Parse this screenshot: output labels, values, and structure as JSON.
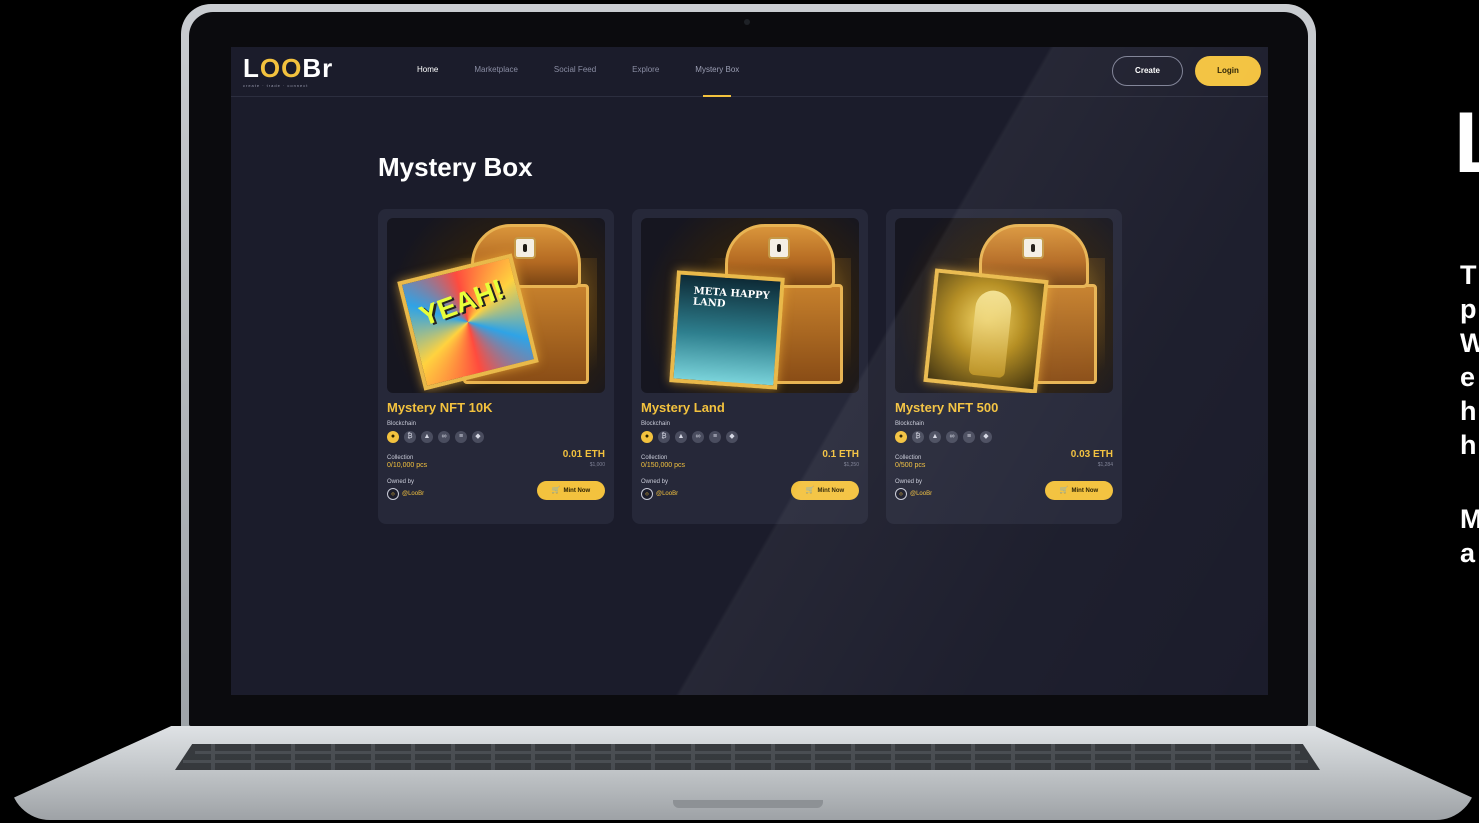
{
  "side": {
    "heading": "L",
    "lines": [
      "T",
      "p",
      "W",
      "e",
      "h",
      "h"
    ],
    "lines2": [
      "M",
      "a"
    ]
  },
  "site": {
    "logo_prefix": "L",
    "logo_mid": "OO",
    "logo_suffix": "Br",
    "logo_tagline": "create · trade · connect",
    "nav": [
      "Home",
      "Marketplace",
      "Social Feed",
      "Explore",
      "Mystery Box"
    ],
    "create_label": "Create",
    "login_label": "Login"
  },
  "page": {
    "title": "Mystery Box",
    "cards": [
      {
        "name": "Mystery NFT 10K",
        "art_text": "YEAH!",
        "blockchain_label": "Blockchain",
        "collection_label": "Collection",
        "collection_value": "0/10,000 pcs",
        "price_eth": "0.01 ETH",
        "price_usd": "$1,000",
        "owned_label": "Owned by",
        "owner": "@LooBr",
        "mint_label": "Mint Now"
      },
      {
        "name": "Mystery Land",
        "art_text": "META HAPPY LAND",
        "blockchain_label": "Blockchain",
        "collection_label": "Collection",
        "collection_value": "0/150,000 pcs",
        "price_eth": "0.1 ETH",
        "price_usd": "$1,250",
        "owned_label": "Owned by",
        "owner": "@LooBr",
        "mint_label": "Mint Now"
      },
      {
        "name": "Mystery NFT 500",
        "art_text": "",
        "blockchain_label": "Blockchain",
        "collection_label": "Collection",
        "collection_value": "0/500 pcs",
        "price_eth": "0.03 ETH",
        "price_usd": "$1,284",
        "owned_label": "Owned by",
        "owner": "@LooBr",
        "mint_label": "Mint Now"
      }
    ],
    "chain_icons": [
      "binance-icon",
      "bitcoin-icon",
      "avalanche-icon",
      "polygon-icon",
      "solana-icon",
      "ethereum-icon"
    ],
    "chain_glyphs": [
      "●",
      "₿",
      "▲",
      "∞",
      "≡",
      "◆"
    ]
  },
  "colors": {
    "accent": "#f3c23e",
    "background": "#1b1c2b",
    "card": "#262839"
  }
}
